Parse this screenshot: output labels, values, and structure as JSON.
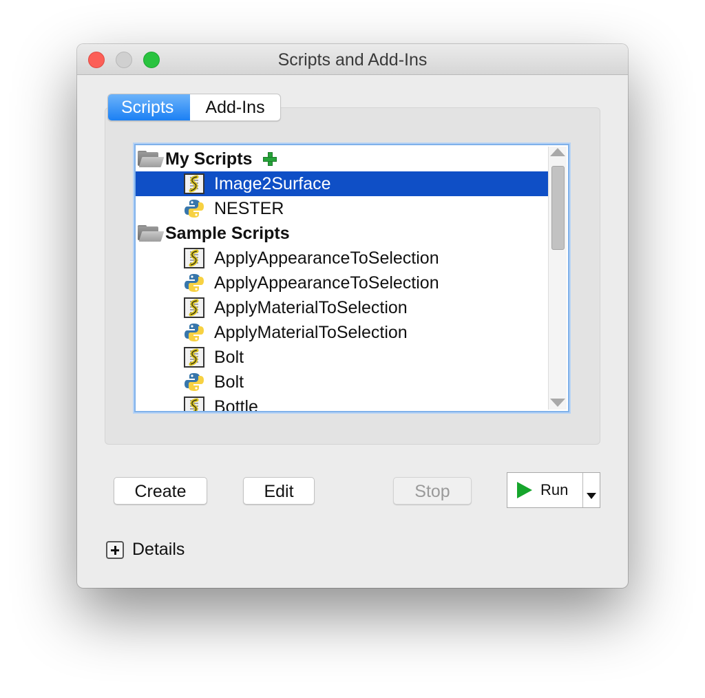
{
  "window": {
    "title": "Scripts and Add-Ins"
  },
  "tabs": [
    {
      "label": "Scripts",
      "active": true
    },
    {
      "label": "Add-Ins",
      "active": false
    }
  ],
  "tree": {
    "groups": [
      {
        "label": "My Scripts",
        "has_add_icon": true,
        "items": [
          {
            "label": "Image2Surface",
            "icon": "script-file-icon",
            "selected": true
          },
          {
            "label": "NESTER",
            "icon": "python-icon",
            "selected": false
          }
        ]
      },
      {
        "label": "Sample Scripts",
        "has_add_icon": false,
        "items": [
          {
            "label": "ApplyAppearanceToSelection",
            "icon": "script-file-icon"
          },
          {
            "label": "ApplyAppearanceToSelection",
            "icon": "python-icon"
          },
          {
            "label": "ApplyMaterialToSelection",
            "icon": "script-file-icon"
          },
          {
            "label": "ApplyMaterialToSelection",
            "icon": "python-icon"
          },
          {
            "label": "Bolt",
            "icon": "script-file-icon"
          },
          {
            "label": "Bolt",
            "icon": "python-icon"
          },
          {
            "label": "Bottle",
            "icon": "script-file-icon"
          }
        ]
      }
    ]
  },
  "buttons": {
    "create": "Create",
    "edit": "Edit",
    "stop": "Stop",
    "run": "Run"
  },
  "details": {
    "label": "Details"
  },
  "colors": {
    "selection": "#0f4fc6",
    "tab_active": "#1b80f4",
    "play": "#16a52c",
    "add": "#27a33a"
  }
}
